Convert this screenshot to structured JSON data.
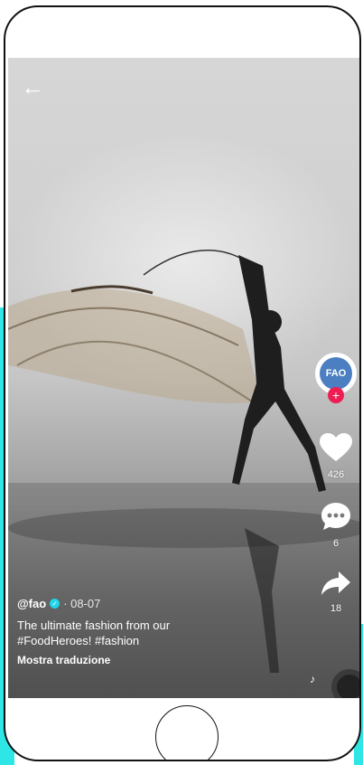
{
  "post": {
    "username": "@fao",
    "date": "· 08-07",
    "description_line1": "The ultimate fashion from our",
    "description_line2": "#FoodHeroes! #fashion",
    "translate_label": "Mostra traduzione"
  },
  "actions": {
    "avatar_text": "FAO",
    "follow_symbol": "+",
    "likes": "426",
    "comments": "6",
    "shares": "18"
  },
  "icons": {
    "back": "back-arrow-icon",
    "like": "heart-icon",
    "comment": "comment-bubble-icon",
    "share": "share-arrow-icon",
    "music": "music-note-icon"
  },
  "colors": {
    "accent_cyan": "#2ee6e6",
    "follow_red": "#ee1d52",
    "verified_blue": "#20d5ec"
  }
}
